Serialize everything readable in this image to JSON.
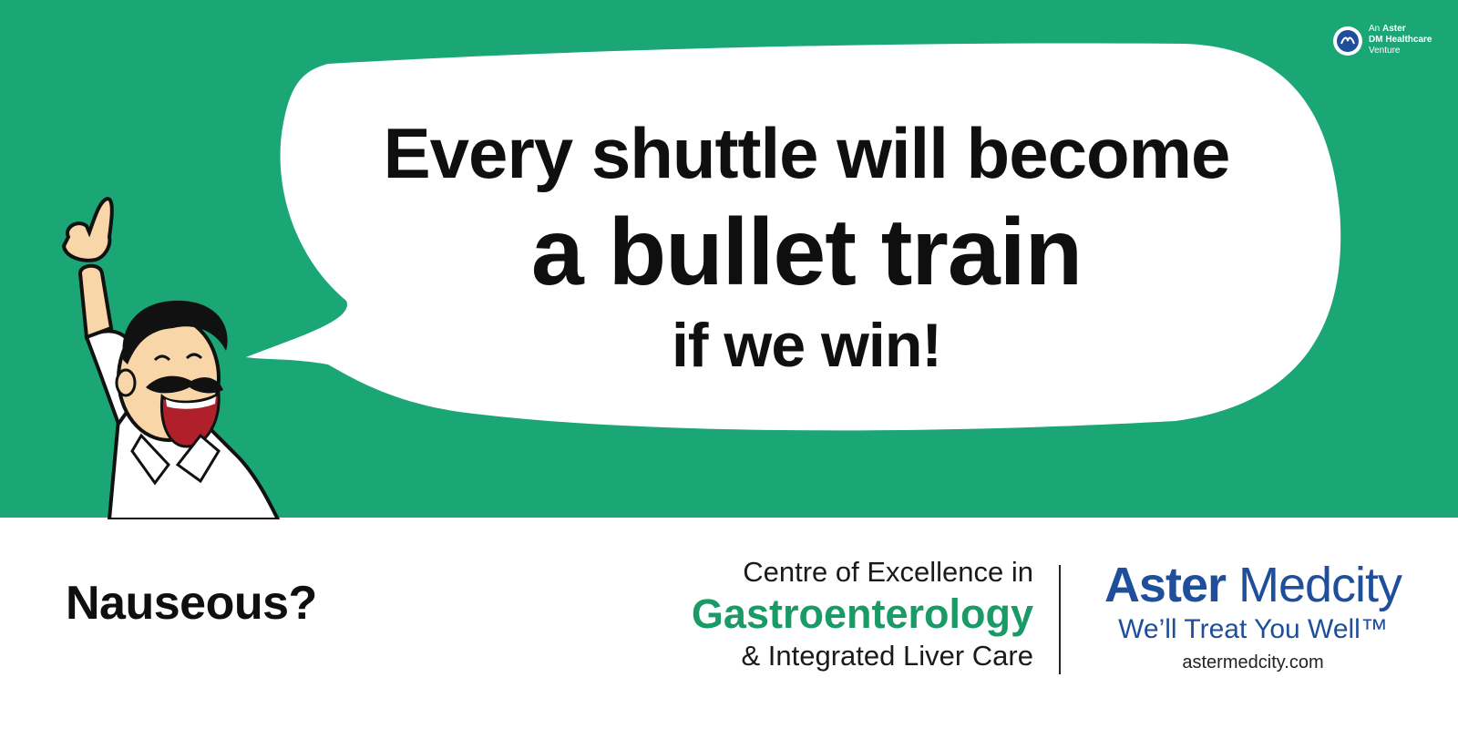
{
  "headline": {
    "line1": "Every shuttle will become",
    "line2": "a bullet train",
    "line3": "if we win!"
  },
  "venture": {
    "line1_prefix": "An ",
    "line1_bold": "Aster",
    "line2": "DM Healthcare",
    "line3": "Venture"
  },
  "footer": {
    "question": "Nauseous?",
    "coe_line1": "Centre of Excellence in",
    "coe_line2": "Gastroenterology",
    "coe_line3": "& Integrated Liver Care",
    "brand_bold": "Aster",
    "brand_rest": " Medcity",
    "tagline": "We’ll Treat You Well™",
    "url": "astermedcity.com"
  },
  "colors": {
    "band_green": "#1ba676",
    "brand_blue": "#1f4e9b",
    "gastro_green": "#1a9a66"
  }
}
